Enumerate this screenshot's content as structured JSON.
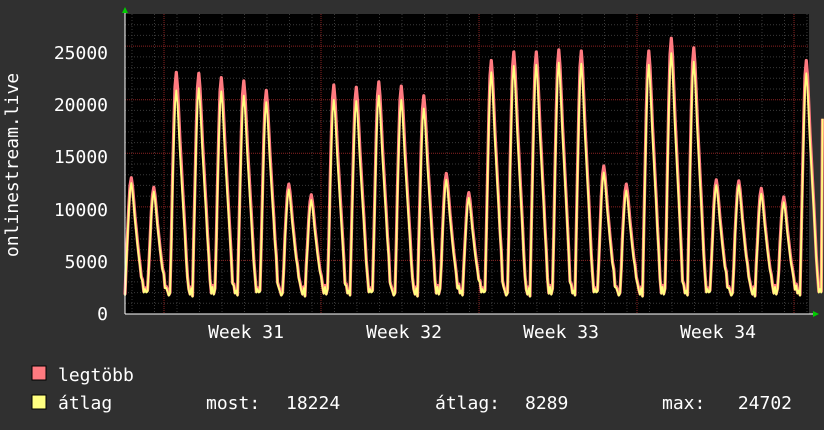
{
  "chart_data": {
    "type": "line",
    "title": "",
    "xlabel": "",
    "ylabel": "onlinestream.live",
    "ylim": [
      0,
      28000
    ],
    "yticks": [
      0,
      5000,
      10000,
      15000,
      20000,
      25000
    ],
    "ytick_labels": [
      "0",
      "5000",
      "10000",
      "15000",
      "20000",
      "25000"
    ],
    "xticks": [
      "Week 31",
      "Week 32",
      "Week 33",
      "Week 34"
    ],
    "grid": true,
    "x": [
      1,
      2,
      3,
      4,
      5,
      6,
      7,
      8,
      9,
      10,
      11,
      12,
      13,
      14,
      15,
      16,
      17,
      18,
      19,
      20,
      21,
      22,
      23,
      24,
      25,
      26,
      27,
      28,
      29,
      30,
      31,
      32,
      33,
      34,
      35,
      36,
      37,
      38,
      39,
      40,
      41,
      42,
      43,
      44
    ],
    "series": [
      {
        "name": "legtöbb",
        "color": "#ff7a80",
        "values": [
          12800,
          11900,
          22700,
          22600,
          22200,
          21900,
          21000,
          12200,
          11200,
          21500,
          21300,
          21800,
          21400,
          20500,
          13200,
          11400,
          23800,
          24600,
          24600,
          24800,
          24700,
          13900,
          12200,
          24700,
          25900,
          25000,
          12600,
          12500,
          11800,
          11000,
          23800
        ]
      },
      {
        "name": "átlag",
        "color": "#ffff80",
        "values": [
          12300,
          11500,
          21000,
          21200,
          20900,
          20500,
          19900,
          11700,
          10700,
          20100,
          20000,
          20500,
          20100,
          19300,
          12600,
          10900,
          22700,
          23300,
          23400,
          23600,
          23500,
          13300,
          11600,
          23400,
          24500,
          23700,
          12100,
          12100,
          11300,
          10500,
          22600
        ]
      }
    ],
    "legend": {
      "position": "bottom-left",
      "items": [
        "legtöbb",
        "átlag"
      ]
    },
    "stats": {
      "now_label": "most:",
      "now_value": "18224",
      "avg_label": "átlag:",
      "avg_value": "8289",
      "max_label": "max:",
      "max_value": "24702"
    }
  },
  "colors": {
    "background": "#303030",
    "plot_background": "#000000",
    "grid_major": "#8a2222",
    "grid_minor": "#3a3a3a",
    "axis": "#ffffff",
    "arrow": "#00cc00"
  }
}
